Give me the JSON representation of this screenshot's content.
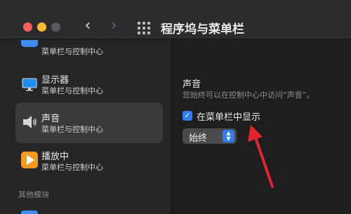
{
  "window": {
    "title": "程序坞与菜单栏"
  },
  "sidebar": {
    "items": [
      {
        "sub": "菜单栏与控制中心",
        "icon": "control-center-icon"
      },
      {
        "name": "显示器",
        "sub": "菜单栏与控制中心",
        "icon": "display-icon"
      },
      {
        "name": "声音",
        "sub": "菜单栏与控制中心",
        "icon": "sound-icon",
        "selected": true
      },
      {
        "name": "播放中",
        "sub": "菜单栏与控制中心",
        "icon": "now-playing-icon"
      }
    ],
    "section_header": "其他模块"
  },
  "content": {
    "title": "声音",
    "description": "您始终可以在控制中心中访问“声音”。",
    "show_in_menubar_label": "在菜单栏中显示",
    "show_in_menubar_checked": true,
    "show_select_value": "始终"
  },
  "colors": {
    "accent": "#2f7cf6",
    "annotation_arrow": "#e3242b"
  }
}
